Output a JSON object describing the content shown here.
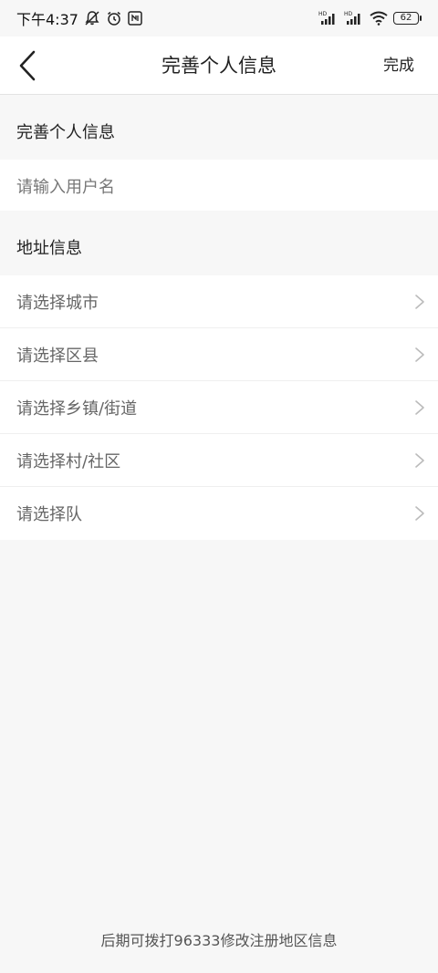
{
  "status_bar": {
    "time": "下午4:37",
    "battery": "62",
    "hd1": "HD",
    "hd2": "HD"
  },
  "nav": {
    "title": "完善个人信息",
    "done_label": "完成"
  },
  "sections": {
    "personal_title": "完善个人信息",
    "username_placeholder": "请输入用户名",
    "address_title": "地址信息"
  },
  "address_rows": [
    {
      "label": "请选择城市"
    },
    {
      "label": "请选择区县"
    },
    {
      "label": "请选择乡镇/街道"
    },
    {
      "label": "请选择村/社区"
    },
    {
      "label": "请选择队"
    }
  ],
  "footer": {
    "note": "后期可拨打96333修改注册地区信息"
  }
}
